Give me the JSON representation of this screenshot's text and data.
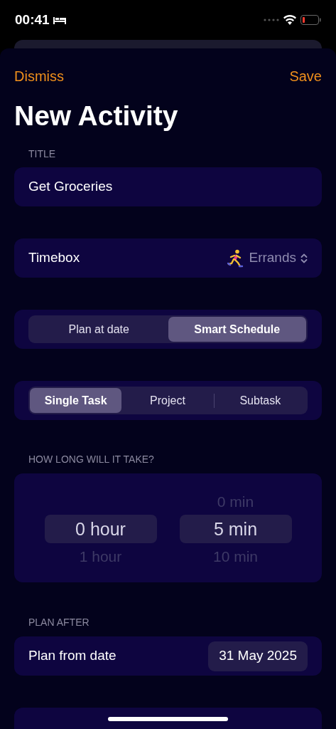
{
  "status_bar": {
    "time": "00:41"
  },
  "nav": {
    "dismiss": "Dismiss",
    "save": "Save"
  },
  "title": "New Activity",
  "title_section": {
    "label": "TITLE",
    "value": "Get Groceries"
  },
  "timebox": {
    "label": "Timebox",
    "value": "Errands"
  },
  "schedule_mode": [
    {
      "label": "Plan at date",
      "selected": false
    },
    {
      "label": "Smart Schedule",
      "selected": true
    }
  ],
  "task_type": [
    {
      "label": "Single Task",
      "selected": true
    },
    {
      "label": "Project",
      "selected": false
    },
    {
      "label": "Subtask",
      "selected": false
    }
  ],
  "duration": {
    "label": "HOW LONG WILL IT TAKE?",
    "columns": [
      {
        "items": [
          {
            "label": "0 hour",
            "selected": true
          },
          {
            "label": "1 hour",
            "selected": false
          }
        ]
      },
      {
        "items": [
          {
            "label": "0 min",
            "selected": false
          },
          {
            "label": "5 min",
            "selected": true
          },
          {
            "label": "10 min",
            "selected": false
          }
        ]
      }
    ]
  },
  "plan_after": {
    "label": "PLAN AFTER",
    "row_label": "Plan from date",
    "date": "31 May 2025"
  }
}
